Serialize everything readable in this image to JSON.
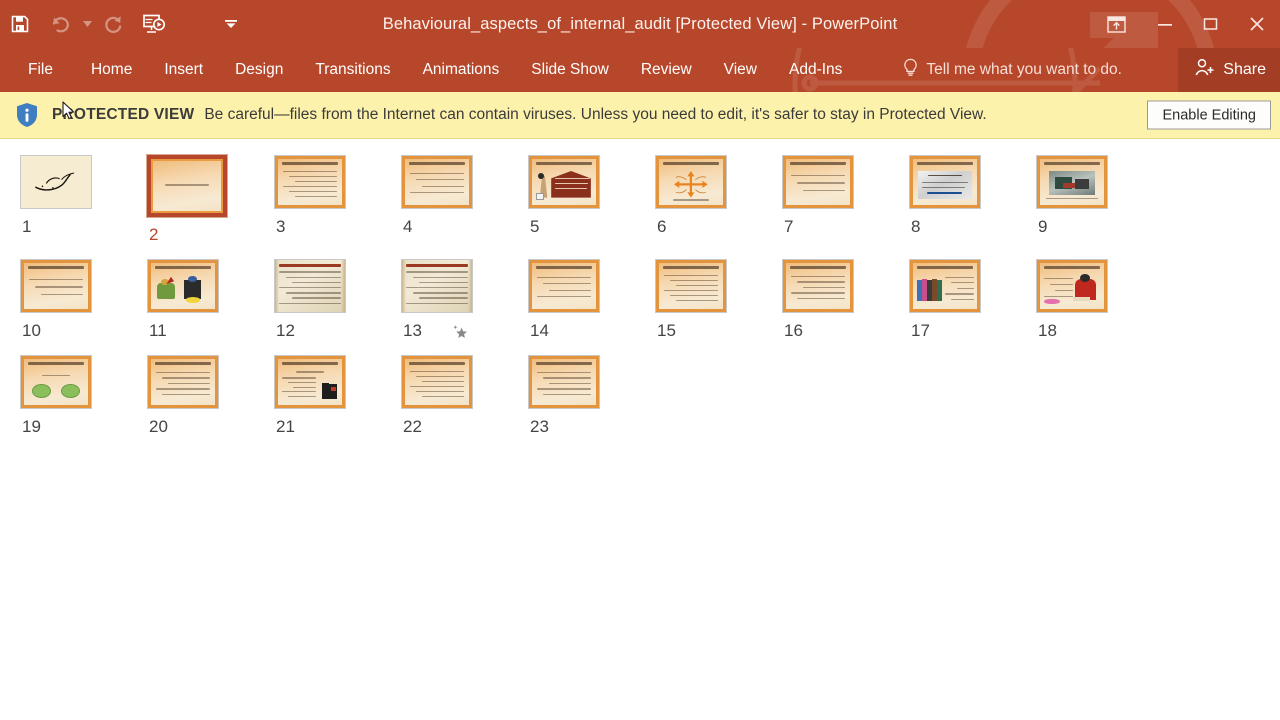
{
  "window": {
    "title": "Behavioural_aspects_of_internal_audit [Protected View] - PowerPoint",
    "accent_color": "#b7472a",
    "share_bg": "#a33e24"
  },
  "quick_access": {
    "items": [
      {
        "name": "save-button",
        "icon": "save-icon",
        "label": "Save",
        "disabled": false
      },
      {
        "name": "undo-button",
        "icon": "undo-icon",
        "label": "Undo",
        "disabled": true
      },
      {
        "name": "redo-button",
        "icon": "redo-icon",
        "label": "Redo",
        "disabled": true
      },
      {
        "name": "start-slideshow-button",
        "icon": "slideshow-icon",
        "label": "Start From Beginning",
        "disabled": false
      }
    ],
    "customize_label": "Customize Quick Access Toolbar",
    "customize_icon": "chevron-down-icon"
  },
  "window_controls": [
    {
      "name": "ribbon-display-options-button",
      "icon": "ribbon-options-icon",
      "label": "Ribbon Display Options",
      "glyph": ""
    },
    {
      "name": "minimize-button",
      "icon": "minimize-icon",
      "label": "Minimize",
      "glyph": "—"
    },
    {
      "name": "restore-button",
      "icon": "restore-icon",
      "label": "Restore Down",
      "glyph": "□"
    },
    {
      "name": "close-button",
      "icon": "close-icon",
      "label": "Close",
      "glyph": "✕"
    }
  ],
  "ribbon_tabs": [
    {
      "label": "File"
    },
    {
      "label": "Home"
    },
    {
      "label": "Insert"
    },
    {
      "label": "Design"
    },
    {
      "label": "Transitions"
    },
    {
      "label": "Animations"
    },
    {
      "label": "Slide Show"
    },
    {
      "label": "Review"
    },
    {
      "label": "View"
    },
    {
      "label": "Add-Ins"
    }
  ],
  "tell_me": {
    "placeholder": "Tell me what you want to do.",
    "icon": "lightbulb-icon"
  },
  "share": {
    "label": "Share",
    "icon": "person-add-icon"
  },
  "protected_view": {
    "icon": "info-shield-icon",
    "strong": "PROTECTED VIEW",
    "message": "Be careful—files from the Internet can contain viruses. Unless you need to edit, it's safer to stay in Protected View.",
    "button_label": "Enable Editing"
  },
  "slides": [
    {
      "number": "1",
      "selected": false,
      "animated": false,
      "style": "cream-calligraphy"
    },
    {
      "number": "2",
      "selected": true,
      "animated": false,
      "style": "title-only"
    },
    {
      "number": "3",
      "selected": false,
      "animated": false,
      "style": "bullets-6"
    },
    {
      "number": "4",
      "selected": false,
      "animated": false,
      "style": "bullets-4"
    },
    {
      "number": "5",
      "selected": false,
      "animated": false,
      "style": "figure-house"
    },
    {
      "number": "6",
      "selected": false,
      "animated": false,
      "style": "diagram-arrows"
    },
    {
      "number": "7",
      "selected": false,
      "animated": false,
      "style": "bullets-3"
    },
    {
      "number": "8",
      "selected": false,
      "animated": false,
      "style": "photo-stones"
    },
    {
      "number": "9",
      "selected": false,
      "animated": false,
      "style": "photo-gray"
    },
    {
      "number": "10",
      "selected": false,
      "animated": false,
      "style": "bullets-3"
    },
    {
      "number": "11",
      "selected": false,
      "animated": false,
      "style": "figure-cartoon"
    },
    {
      "number": "12",
      "selected": false,
      "animated": false,
      "style": "parchment"
    },
    {
      "number": "13",
      "selected": false,
      "animated": true,
      "style": "parchment"
    },
    {
      "number": "14",
      "selected": false,
      "animated": false,
      "style": "bullets-4"
    },
    {
      "number": "15",
      "selected": false,
      "animated": false,
      "style": "bullets-6"
    },
    {
      "number": "16",
      "selected": false,
      "animated": false,
      "style": "bullets-5"
    },
    {
      "number": "17",
      "selected": false,
      "animated": false,
      "style": "figure-people"
    },
    {
      "number": "18",
      "selected": false,
      "animated": false,
      "style": "figure-reader"
    },
    {
      "number": "19",
      "selected": false,
      "animated": false,
      "style": "two-ovals"
    },
    {
      "number": "20",
      "selected": false,
      "animated": false,
      "style": "bullets-5"
    },
    {
      "number": "21",
      "selected": false,
      "animated": false,
      "style": "figure-duo"
    },
    {
      "number": "22",
      "selected": false,
      "animated": false,
      "style": "bullets-6"
    },
    {
      "number": "23",
      "selected": false,
      "animated": false,
      "style": "bullets-5"
    }
  ],
  "animation_star": {
    "name": "animation-indicator-icon",
    "tooltip": "Play Animations"
  }
}
